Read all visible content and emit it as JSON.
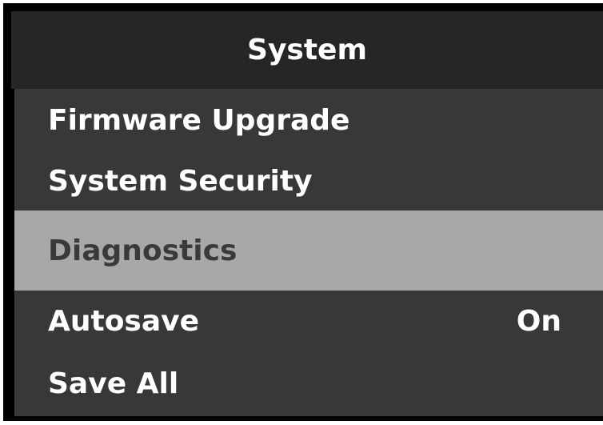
{
  "menu": {
    "title": "System",
    "items": [
      {
        "label": "Firmware Upgrade",
        "value": ""
      },
      {
        "label": "System Security",
        "value": ""
      },
      {
        "label": "Diagnostics",
        "value": "",
        "selected": true
      },
      {
        "label": "Autosave",
        "value": "On"
      },
      {
        "label": "Save All",
        "value": ""
      }
    ]
  },
  "colors": {
    "title_bg": "#262626",
    "menu_bg": "#383838",
    "selected_bg": "#a8a8a8",
    "selected_text": "#3a3a3a",
    "text": "#ffffff"
  }
}
